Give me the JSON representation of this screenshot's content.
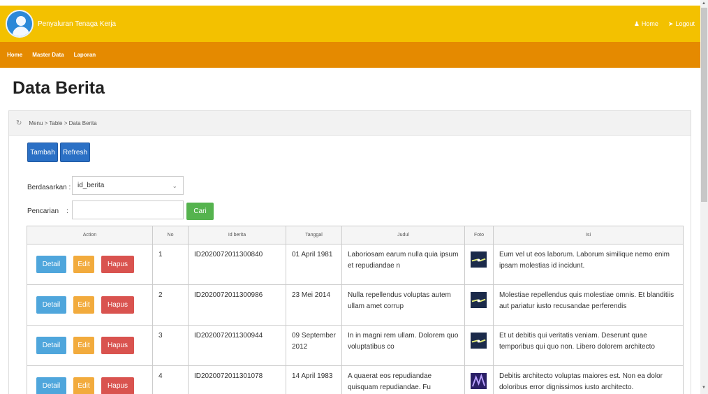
{
  "header": {
    "app_title": "Penyaluran Tenaga Kerja",
    "home_label": "Home",
    "logout_label": "Logout"
  },
  "menu": [
    {
      "label": "Home"
    },
    {
      "label": "Master Data"
    },
    {
      "label": "Laporan"
    }
  ],
  "page": {
    "title": "Data Berita",
    "breadcrumb": "Menu > Table > Data Berita"
  },
  "toolbar": {
    "tambah_label": "Tambah",
    "refresh_label": "Refresh"
  },
  "filter": {
    "berdasarkan_label": "Berdasarkan :",
    "selected": "id_berita",
    "pencarian_label": "Pencarian",
    "pencarian_colon": ":",
    "search_value": "",
    "cari_label": "Cari"
  },
  "table": {
    "headers": {
      "action": "Action",
      "no": "No",
      "id": "Id berita",
      "tanggal": "Tanggal",
      "judul": "Judul",
      "foto": "Foto",
      "isi": "Isi"
    },
    "action_labels": {
      "detail": "Detail",
      "edit": "Edit",
      "hapus": "Hapus"
    },
    "rows": [
      {
        "no": "1",
        "id": "ID2020072011300840",
        "tanggal": "01 April 1981",
        "judul": "Laboriosam earum nulla quia ipsum et repudiandae n",
        "isi": "Eum vel ut eos laborum. Laborum similique nemo enim ipsam molestias id incidunt.",
        "foto_colors": [
          "#1b2a4a",
          "#e7f07a"
        ]
      },
      {
        "no": "2",
        "id": "ID2020072011300986",
        "tanggal": "23 Mei 2014",
        "judul": "Nulla repellendus voluptas autem ullam amet corrup",
        "isi": "Molestiae repellendus quis molestiae omnis. Et blanditiis aut pariatur iusto recusandae perferendis",
        "foto_colors": [
          "#1b2a4a",
          "#e7f07a"
        ]
      },
      {
        "no": "3",
        "id": "ID2020072011300944",
        "tanggal": "09 September 2012",
        "judul": "In in magni rem ullam. Dolorem quo voluptatibus co",
        "isi": "Et ut debitis qui veritatis veniam. Deserunt quae temporibus qui quo non. Libero dolorem architecto",
        "foto_colors": [
          "#1b2a4a",
          "#e7f07a"
        ]
      },
      {
        "no": "4",
        "id": "ID2020072011301078",
        "tanggal": "14 April 1983",
        "judul": "A quaerat eos repudiandae quisquam repudiandae. Fu",
        "isi": "Debitis architecto voluptas maiores est. Non ea dolor doloribus error dignissimos iusto architecto.",
        "foto_colors": [
          "#2a1f66",
          "#b9a0ff"
        ]
      }
    ]
  },
  "colors": {
    "header": "#f3c100",
    "menubar": "#e58a00",
    "primary": "#2b70c5",
    "success": "#55b34e",
    "info": "#4fa6dc",
    "warning": "#f2ab3d",
    "danger": "#d9534f"
  },
  "icons": {
    "header_left": "user-avatar-icon",
    "home": "user-icon",
    "logout": "arrow-icon",
    "breadcrumb": "refresh-icon",
    "select": "chevron-down-icon"
  }
}
